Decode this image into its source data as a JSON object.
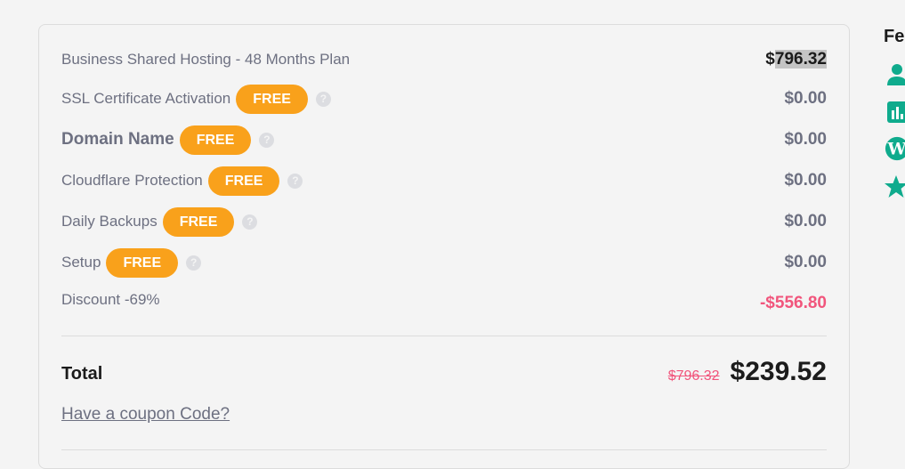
{
  "order_summary": {
    "items": [
      {
        "label": "Business Shared Hosting - 48 Months Plan",
        "badge": null,
        "has_help": false,
        "price_prefix": "$",
        "price_value": "796.32",
        "style": "plan"
      },
      {
        "label": "SSL Certificate Activation",
        "badge": "FREE",
        "has_help": true,
        "price": "$0.00",
        "style": "normal"
      },
      {
        "label": "Domain Name",
        "badge": "FREE",
        "has_help": true,
        "price": "$0.00",
        "style": "bold"
      },
      {
        "label": "Cloudflare Protection",
        "badge": "FREE",
        "has_help": true,
        "price": "$0.00",
        "style": "normal"
      },
      {
        "label": "Daily Backups",
        "badge": "FREE",
        "has_help": true,
        "price": "$0.00",
        "style": "normal"
      },
      {
        "label": "Setup",
        "badge": "FREE",
        "has_help": true,
        "price": "$0.00",
        "style": "normal"
      }
    ],
    "discount": {
      "label": "Discount -69%",
      "amount": "-$556.80"
    },
    "total": {
      "label": "Total",
      "original_price": "$796.32",
      "final_price": "$239.52"
    },
    "coupon_link": "Have a coupon Code?",
    "help_glyph": "?"
  },
  "features_panel": {
    "title": "Fe",
    "icons": [
      "user-icon",
      "chart-icon",
      "wordpress-icon",
      "star-icon"
    ]
  },
  "colors": {
    "badge": "#f9a11b",
    "discount": "#f1557c",
    "feature_icon": "#0fab8d",
    "text_muted": "#6d7081"
  }
}
